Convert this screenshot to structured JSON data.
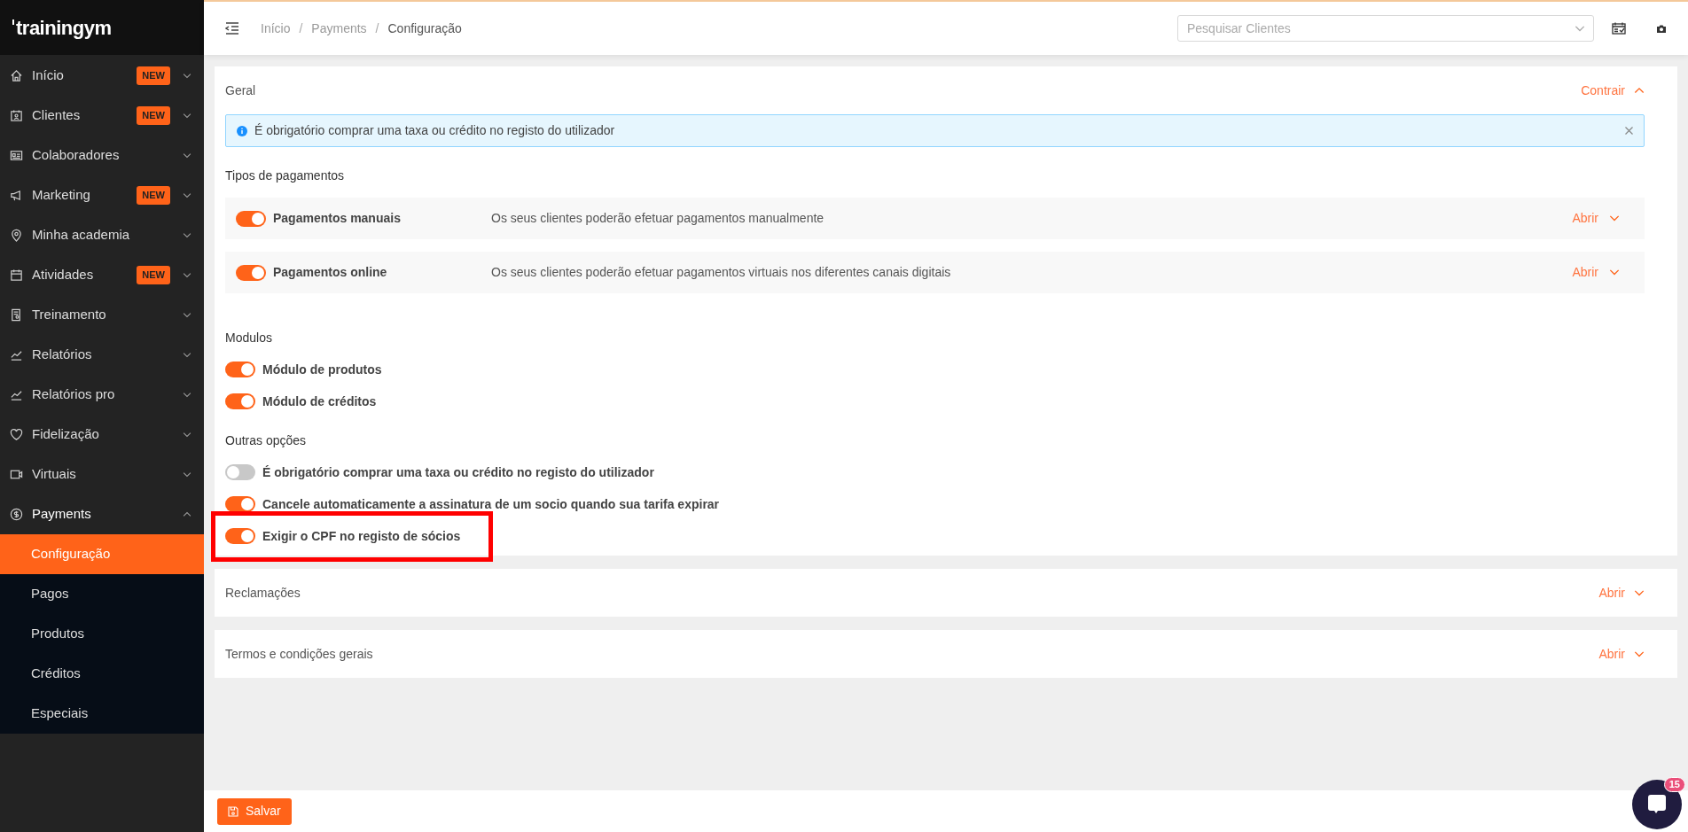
{
  "logo": {
    "text": "trainingym"
  },
  "sidebar": {
    "items": [
      {
        "label": "Início",
        "badge": "NEW",
        "expanded": false
      },
      {
        "label": "Clientes",
        "badge": "NEW",
        "expanded": false
      },
      {
        "label": "Colaboradores",
        "expanded": false
      },
      {
        "label": "Marketing",
        "badge": "NEW",
        "expanded": false
      },
      {
        "label": "Minha academia",
        "expanded": false
      },
      {
        "label": "Atividades",
        "badge": "NEW",
        "expanded": false
      },
      {
        "label": "Treinamento",
        "expanded": false
      },
      {
        "label": "Relatórios",
        "expanded": false
      },
      {
        "label": "Relatórios pro",
        "expanded": false
      },
      {
        "label": "Fidelização",
        "expanded": false
      },
      {
        "label": "Virtuais",
        "expanded": false
      },
      {
        "label": "Payments",
        "expanded": true,
        "children": [
          {
            "label": "Configuração",
            "selected": true
          },
          {
            "label": "Pagos",
            "selected": false
          },
          {
            "label": "Produtos",
            "selected": false
          },
          {
            "label": "Créditos",
            "selected": false
          },
          {
            "label": "Especiais",
            "selected": false
          }
        ]
      }
    ]
  },
  "topbar": {
    "breadcrumb": [
      "Início",
      "Payments",
      "Configuração"
    ],
    "separator": "/",
    "search": {
      "placeholder": "Pesquisar Clientes"
    }
  },
  "sections": [
    {
      "title": "Geral",
      "expanded": true,
      "toggle_label": "Contrair",
      "alert": {
        "text": "É obrigatório comprar uma taxa ou crédito no registo do utilizador"
      },
      "groups": [
        {
          "title": "Tipos de pagamentos",
          "kind": "panels",
          "items": [
            {
              "label": "Pagamentos manuais",
              "description": "Os seus clientes poderão efetuar pagamentos manualmente",
              "on": true,
              "action": "Abrir"
            },
            {
              "label": "Pagamentos online",
              "description": "Os seus clientes poderão efetuar pagamentos virtuais nos diferentes canais digitais",
              "on": true,
              "action": "Abrir"
            }
          ]
        },
        {
          "title": "Modulos",
          "kind": "list",
          "items": [
            {
              "label": "Módulo de produtos",
              "on": true,
              "highlighted": false
            },
            {
              "label": "Módulo de créditos",
              "on": true,
              "highlighted": false
            }
          ]
        },
        {
          "title": "Outras opções",
          "kind": "list",
          "items": [
            {
              "label": "É obrigatório comprar uma taxa ou crédito no registo do utilizador",
              "on": false,
              "highlighted": false
            },
            {
              "label": "Cancele automaticamente a assinatura de um socio quando sua tarifa expirar",
              "on": true,
              "highlighted": false
            },
            {
              "label": "Exigir o CPF no registo de sócios",
              "on": true,
              "highlighted": true
            }
          ]
        }
      ]
    },
    {
      "title": "Reclamações",
      "expanded": false,
      "toggle_label": "Abrir"
    },
    {
      "title": "Termos e condições gerais",
      "expanded": false,
      "toggle_label": "Abrir"
    }
  ],
  "save_button": {
    "label": "Salvar"
  },
  "chat": {
    "badge": "15"
  }
}
